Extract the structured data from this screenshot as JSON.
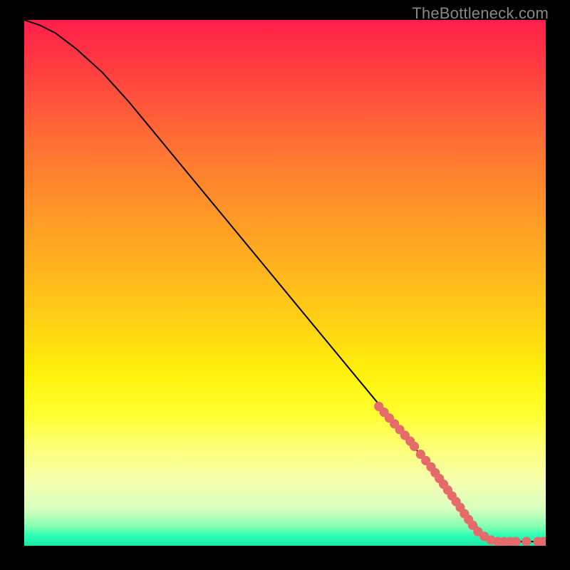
{
  "watermark": "TheBottleneck.com",
  "colors": {
    "curve": "#000000",
    "dot_fill": "#e56b6b",
    "dot_stroke": "#e56b6b",
    "gradient_top": "#ff1e4a",
    "gradient_mid": "#ffff30",
    "gradient_bottom": "#19e8a5"
  },
  "chart_data": {
    "type": "line",
    "title": "",
    "xlabel": "",
    "ylabel": "",
    "xlim": [
      0,
      100
    ],
    "ylim": [
      0,
      100
    ],
    "grid": false,
    "series": [
      {
        "name": "curve",
        "x": [
          0,
          3,
          6,
          10,
          15,
          20,
          25,
          30,
          35,
          40,
          45,
          50,
          55,
          60,
          65,
          70,
          75,
          80,
          82,
          84,
          86,
          88,
          90,
          92,
          94,
          96,
          98,
          100
        ],
        "y": [
          100,
          99,
          97.5,
          94.5,
          90,
          84.5,
          78.5,
          72.5,
          66.5,
          60.5,
          54.5,
          48.5,
          42.5,
          36.5,
          30.5,
          24.5,
          18.5,
          12.5,
          10,
          7,
          4.5,
          2.3,
          1.2,
          0.8,
          0.8,
          0.8,
          0.8,
          0.8
        ]
      }
    ],
    "dots": {
      "name": "highlighted-points",
      "points": [
        {
          "x": 68,
          "y": 26.5
        },
        {
          "x": 69,
          "y": 25.4
        },
        {
          "x": 70,
          "y": 24.3
        },
        {
          "x": 71,
          "y": 23.2
        },
        {
          "x": 72,
          "y": 22.1
        },
        {
          "x": 73,
          "y": 21.0
        },
        {
          "x": 74,
          "y": 19.9
        },
        {
          "x": 74.8,
          "y": 18.9
        },
        {
          "x": 76,
          "y": 17.4
        },
        {
          "x": 77,
          "y": 16.2
        },
        {
          "x": 78,
          "y": 15.0
        },
        {
          "x": 78.8,
          "y": 13.9
        },
        {
          "x": 79.6,
          "y": 12.8
        },
        {
          "x": 80.4,
          "y": 11.7
        },
        {
          "x": 81.2,
          "y": 10.6
        },
        {
          "x": 82,
          "y": 9.5
        },
        {
          "x": 82.8,
          "y": 8.4
        },
        {
          "x": 83.6,
          "y": 7.3
        },
        {
          "x": 84.4,
          "y": 6.1
        },
        {
          "x": 85.2,
          "y": 5.0
        },
        {
          "x": 86,
          "y": 3.9
        },
        {
          "x": 87,
          "y": 2.7
        },
        {
          "x": 88.2,
          "y": 1.8
        },
        {
          "x": 89.5,
          "y": 1.1
        },
        {
          "x": 90.8,
          "y": 0.8
        },
        {
          "x": 92,
          "y": 0.8
        },
        {
          "x": 93.2,
          "y": 0.8
        },
        {
          "x": 94.3,
          "y": 0.8
        },
        {
          "x": 96.3,
          "y": 0.8
        },
        {
          "x": 98.5,
          "y": 0.8
        },
        {
          "x": 99.5,
          "y": 0.8
        }
      ],
      "radius_data_units": 0.9
    }
  }
}
